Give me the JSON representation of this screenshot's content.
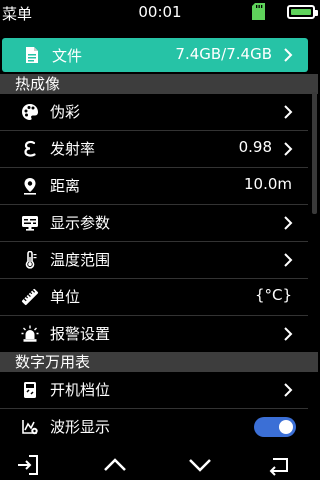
{
  "status_bar": {
    "title": "菜单",
    "time": "00:01"
  },
  "file_row": {
    "label": "文件",
    "value": "7.4GB/7.4GB"
  },
  "sections": {
    "thermal": "热成像",
    "multimeter": "数字万用表"
  },
  "thermal_items": [
    {
      "label": "伪彩",
      "value": ""
    },
    {
      "label": "发射率",
      "value": "0.98"
    },
    {
      "label": "距离",
      "value": "10.0m"
    },
    {
      "label": "显示参数",
      "value": ""
    },
    {
      "label": "温度范围",
      "value": ""
    },
    {
      "label": "单位",
      "value": "{°C}"
    },
    {
      "label": "报警设置",
      "value": ""
    }
  ],
  "multimeter_items": [
    {
      "label": "开机档位",
      "value": ""
    },
    {
      "label": "波形显示",
      "value": ""
    }
  ],
  "colors": {
    "accent": "#26c3a6",
    "toggle_on": "#3b6fd6",
    "battery": "#5fd35b",
    "section_bg": "#3d3d3d"
  }
}
